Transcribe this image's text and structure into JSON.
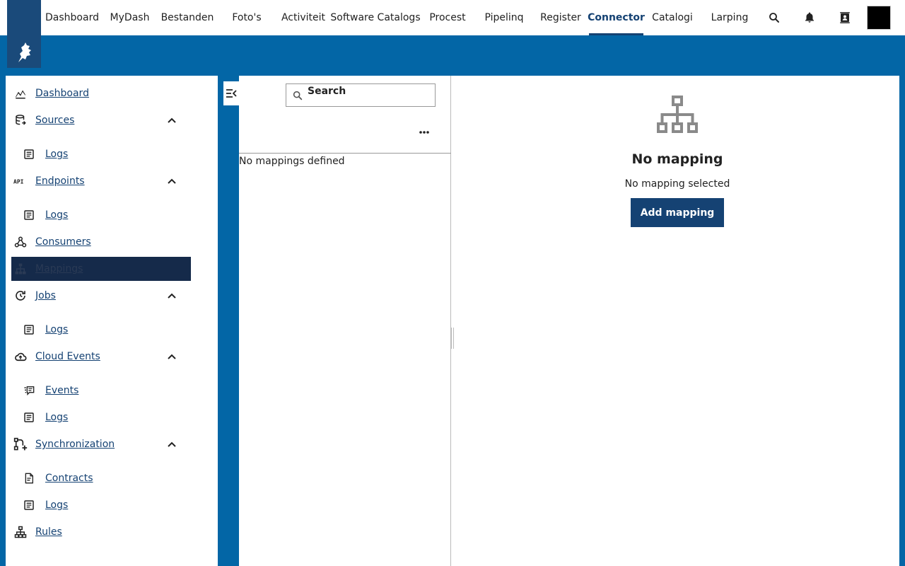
{
  "nav": {
    "items": [
      {
        "label": "Dashboard"
      },
      {
        "label": "MyDash"
      },
      {
        "label": "Bestanden"
      },
      {
        "label": "Foto's"
      },
      {
        "label": "Activiteit"
      },
      {
        "label": "Software Catalogs"
      },
      {
        "label": "Procest"
      },
      {
        "label": "Pipelinq"
      },
      {
        "label": "Register"
      },
      {
        "label": "Connector"
      },
      {
        "label": "Catalogi"
      },
      {
        "label": "Larping"
      }
    ],
    "active": "Connector",
    "icons": [
      "search-icon",
      "bell-icon",
      "contacts-icon"
    ]
  },
  "sidebar": {
    "items": [
      {
        "label": "Dashboard",
        "icon": "chart-icon"
      },
      {
        "label": "Sources",
        "icon": "database-icon",
        "expanded": true
      },
      {
        "label": "Logs",
        "icon": "logs-icon"
      },
      {
        "label": "Endpoints",
        "icon": "api-icon",
        "expanded": true
      },
      {
        "label": "Logs",
        "icon": "logs-icon"
      },
      {
        "label": "Consumers",
        "icon": "webhook-icon"
      },
      {
        "label": "Mappings",
        "icon": "sitemap-icon",
        "active": true
      },
      {
        "label": "Jobs",
        "icon": "refresh-icon",
        "expanded": true
      },
      {
        "label": "Logs",
        "icon": "logs-icon"
      },
      {
        "label": "Cloud Events",
        "icon": "cloud-icon",
        "expanded": true
      },
      {
        "label": "Events",
        "icon": "events-icon"
      },
      {
        "label": "Logs",
        "icon": "logs-icon"
      },
      {
        "label": "Synchronization",
        "icon": "sync-icon",
        "expanded": true
      },
      {
        "label": "Contracts",
        "icon": "contract-icon"
      },
      {
        "label": "Logs",
        "icon": "logs-icon"
      },
      {
        "label": "Rules",
        "icon": "sitemap-icon"
      }
    ]
  },
  "list": {
    "search_label": "Search",
    "empty_text": "No mappings defined"
  },
  "detail": {
    "title": "No mapping",
    "subtitle": "No mapping selected",
    "add_label": "Add mapping"
  },
  "colors": {
    "brand_dark": "#154273",
    "band": "#0366a6",
    "active_sidebar": "#152a4a"
  }
}
